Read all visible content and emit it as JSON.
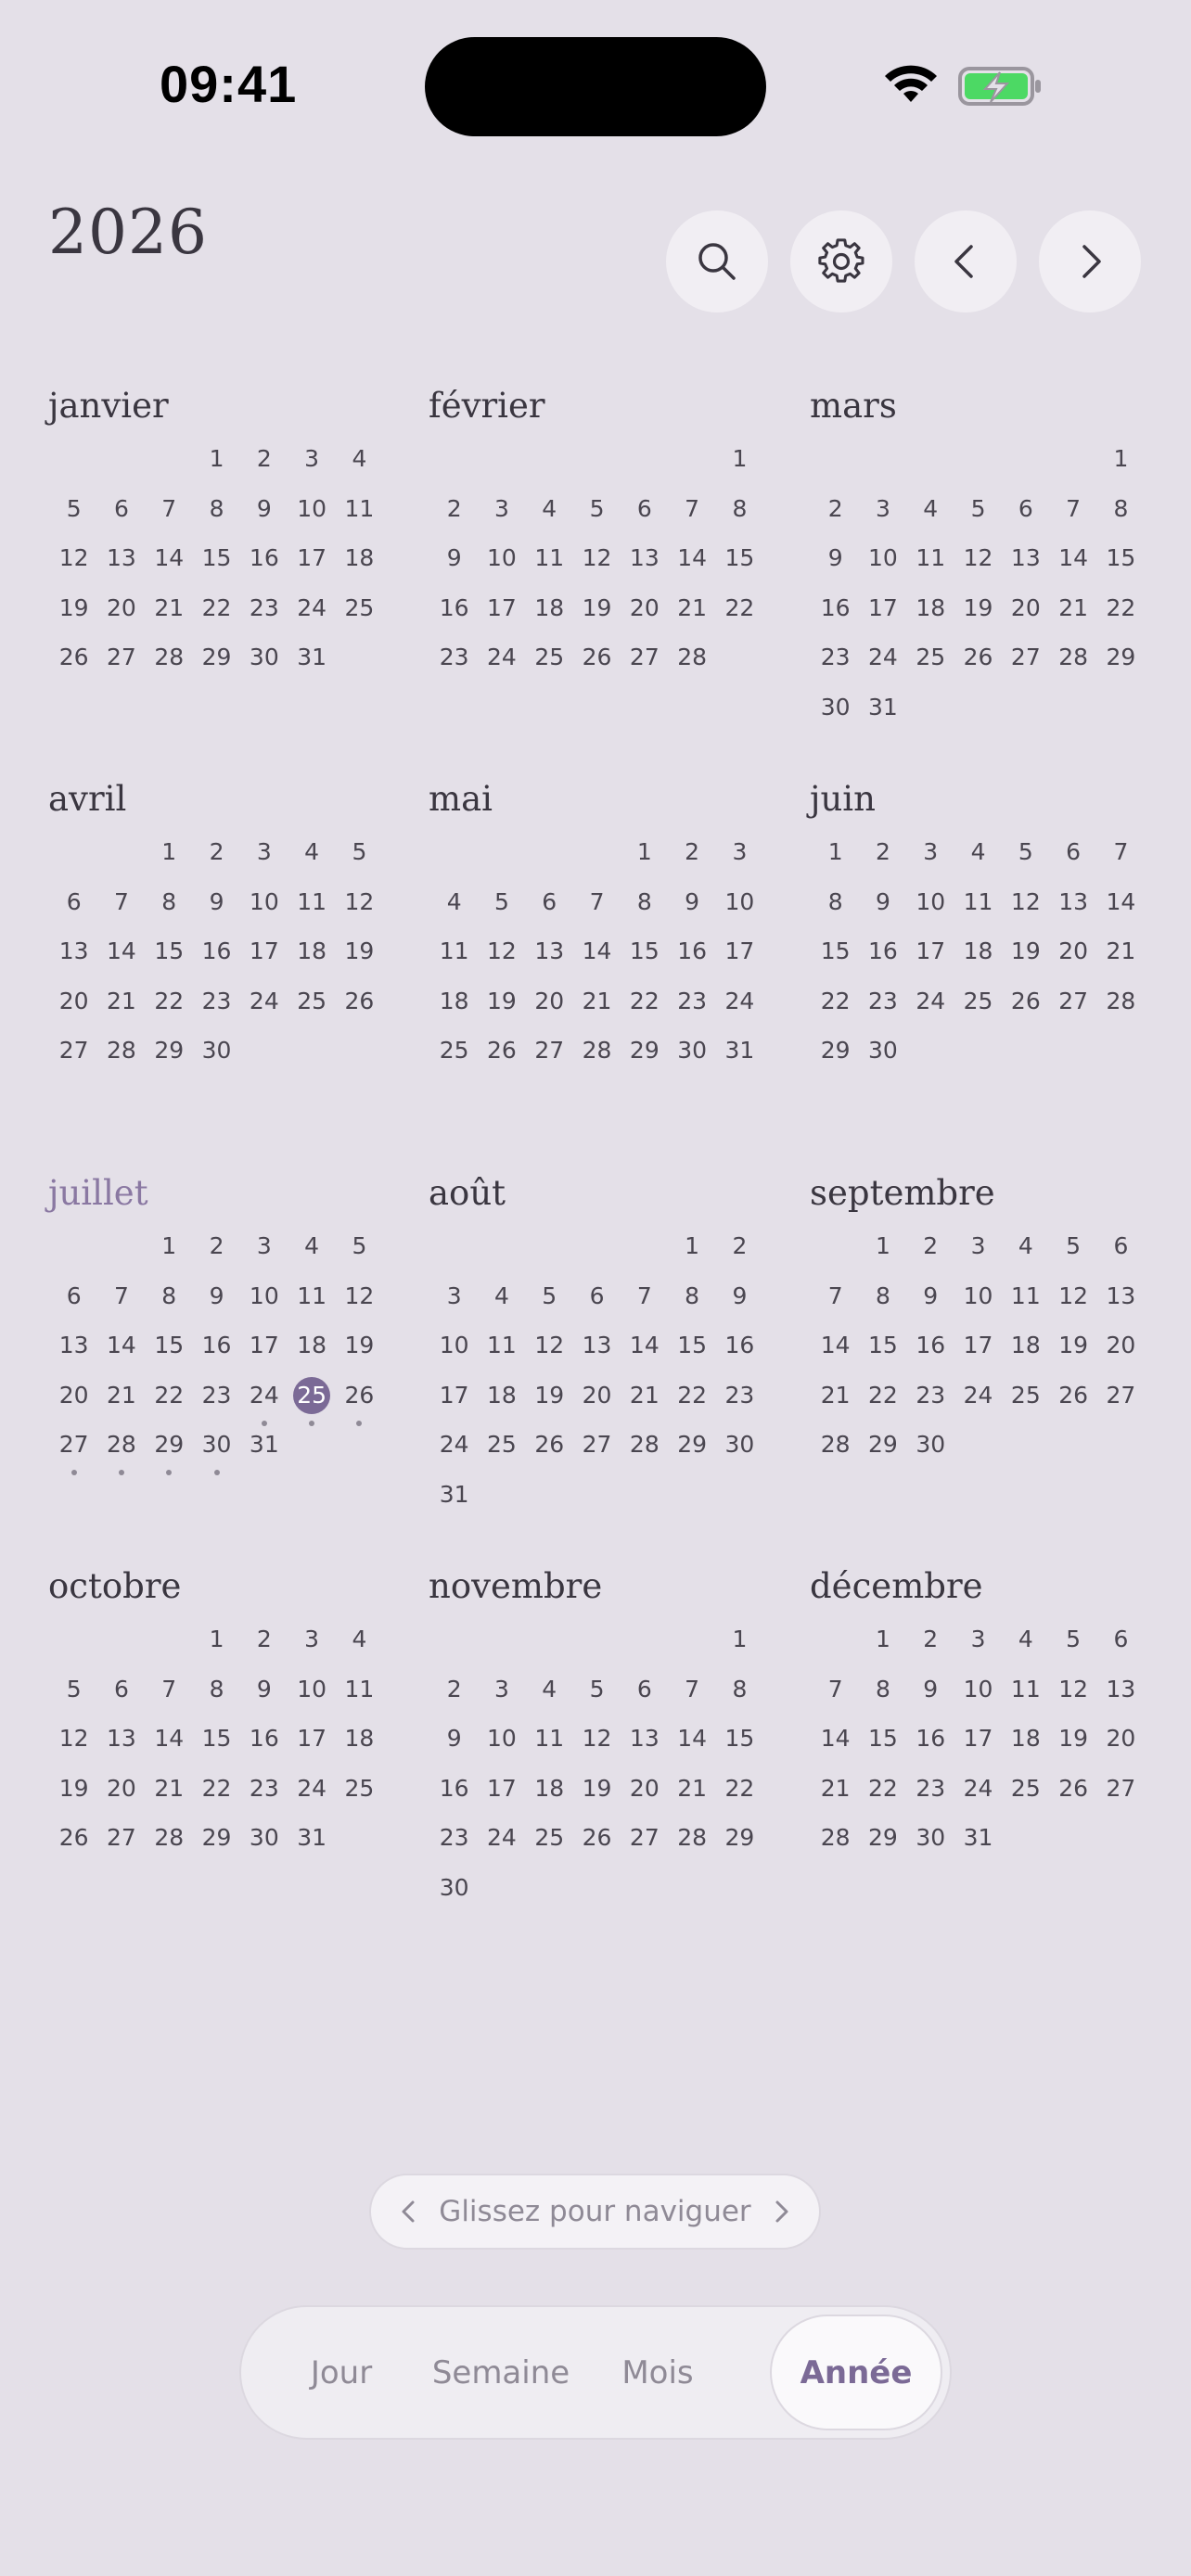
{
  "status": {
    "time": "09:41"
  },
  "header": {
    "year": "2026",
    "buttons": [
      {
        "name": "search-button",
        "icon": "search-icon"
      },
      {
        "name": "settings-button",
        "icon": "gear-icon"
      },
      {
        "name": "previous-year-button",
        "icon": "chevron-left-icon"
      },
      {
        "name": "next-year-button",
        "icon": "chevron-right-icon"
      }
    ]
  },
  "colors": {
    "accent": "#7b6a96",
    "background": "#e4e0e8",
    "battery": "#4cd964"
  },
  "today": {
    "month_index": 6,
    "day": 25
  },
  "months": [
    {
      "name": "janvier",
      "offset": 3,
      "days": 31
    },
    {
      "name": "février",
      "offset": 6,
      "days": 28
    },
    {
      "name": "mars",
      "offset": 6,
      "days": 31
    },
    {
      "name": "avril",
      "offset": 2,
      "days": 30
    },
    {
      "name": "mai",
      "offset": 4,
      "days": 31
    },
    {
      "name": "juin",
      "offset": 0,
      "days": 30
    },
    {
      "name": "juillet",
      "offset": 2,
      "days": 31,
      "current": true,
      "event_days": [
        24,
        25,
        26,
        27,
        28,
        29,
        30
      ]
    },
    {
      "name": "août",
      "offset": 5,
      "days": 31
    },
    {
      "name": "septembre",
      "offset": 1,
      "days": 30
    },
    {
      "name": "octobre",
      "offset": 3,
      "days": 31
    },
    {
      "name": "novembre",
      "offset": 6,
      "days": 30
    },
    {
      "name": "décembre",
      "offset": 1,
      "days": 31
    }
  ],
  "hint": {
    "label": "Glissez pour naviguer"
  },
  "views": [
    {
      "label": "Jour",
      "active": false
    },
    {
      "label": "Semaine",
      "active": false
    },
    {
      "label": "Mois",
      "active": false
    },
    {
      "label": "Année",
      "active": true
    }
  ]
}
